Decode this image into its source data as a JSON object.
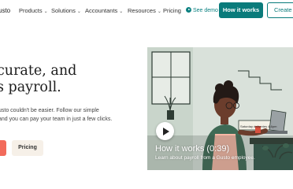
{
  "nav": {
    "brand": "usto",
    "items": [
      {
        "label": "Products",
        "has_dropdown": true
      },
      {
        "label": "Solutions",
        "has_dropdown": true
      },
      {
        "label": "Accountants",
        "has_dropdown": true
      },
      {
        "label": "Resources",
        "has_dropdown": true
      },
      {
        "label": "Pricing",
        "has_dropdown": false
      }
    ],
    "see_demo": "See demo",
    "how_it_works": "How it works",
    "create": "Create a"
  },
  "hero": {
    "headline_line1": "curate, and",
    "headline_line2": "s payroll.",
    "sub_line1": "usto couldn't be easier. Follow our simple",
    "sub_line2": "and you can pay your team in just a few clicks.",
    "pricing_button": "Pricing"
  },
  "video": {
    "title": "How it works (0:39)",
    "subtitle": "Learn about payroll from a Gusto employee.",
    "sign_text": "Saturday deliveries 4-6pm"
  },
  "colors": {
    "teal": "#0a7b7b",
    "cta_coral": "#f26b5b",
    "pricing_bg": "#f6f0e8"
  }
}
